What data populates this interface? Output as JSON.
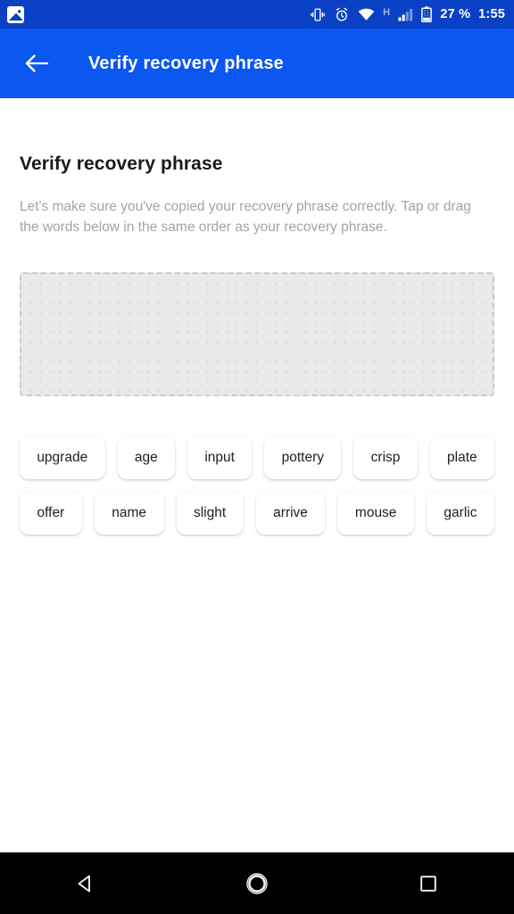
{
  "status_bar": {
    "notification_icon": "gallery-icon",
    "icons": [
      "vibrate-icon",
      "alarm-icon",
      "wifi-icon",
      "hspa-icon",
      "signal-icon",
      "battery-icon"
    ],
    "network_label": "H",
    "battery_percent": "27 %",
    "time": "1:55",
    "background_color": "#0a41c4"
  },
  "app_bar": {
    "back_icon": "back-arrow-icon",
    "title": "Verify recovery phrase",
    "background_color": "#0b57f0"
  },
  "main": {
    "heading": "Verify recovery phrase",
    "description": "Let's make sure you've copied your recovery phrase correctly. Tap or drag the words below in the same order as your recovery phrase.",
    "drop_zone": {
      "name": "recovery-phrase-drop-zone",
      "content": "",
      "border_color": "#c9cccf",
      "fill_color": "#e9eaeb"
    },
    "word_rows": [
      [
        "upgrade",
        "age",
        "input",
        "pottery",
        "crisp",
        "plate"
      ],
      [
        "offer",
        "name",
        "slight",
        "arrive",
        "mouse",
        "garlic"
      ]
    ]
  },
  "nav_bar": {
    "buttons": [
      "back-nav-icon",
      "home-nav-icon",
      "recents-nav-icon"
    ],
    "background_color": "#000000"
  }
}
